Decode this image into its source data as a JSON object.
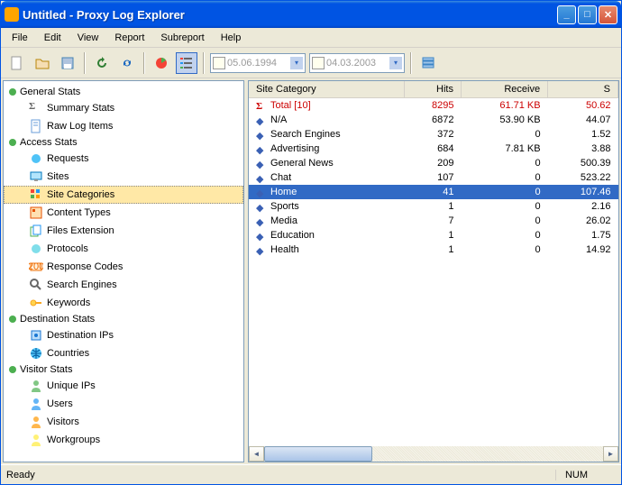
{
  "window": {
    "title": "Untitled - Proxy Log Explorer"
  },
  "menu": [
    "File",
    "Edit",
    "View",
    "Report",
    "Subreport",
    "Help"
  ],
  "dates": {
    "from": "05.06.1994",
    "to": "04.03.2003"
  },
  "tree": [
    {
      "type": "group",
      "label": "General Stats",
      "color": "#4caf50"
    },
    {
      "type": "item",
      "label": "Summary Stats",
      "icon": "sigma"
    },
    {
      "type": "item",
      "label": "Raw Log Items",
      "icon": "doc"
    },
    {
      "type": "group",
      "label": "Access Stats",
      "color": "#4caf50"
    },
    {
      "type": "item",
      "label": "Requests",
      "icon": "ball-blue"
    },
    {
      "type": "item",
      "label": "Sites",
      "icon": "monitor"
    },
    {
      "type": "item",
      "label": "Site Categories",
      "icon": "grid",
      "selected": true
    },
    {
      "type": "item",
      "label": "Content Types",
      "icon": "content"
    },
    {
      "type": "item",
      "label": "Files Extension",
      "icon": "files"
    },
    {
      "type": "item",
      "label": "Protocols",
      "icon": "ball-cyan"
    },
    {
      "type": "item",
      "label": "Response Codes",
      "icon": "response"
    },
    {
      "type": "item",
      "label": "Search Engines",
      "icon": "search"
    },
    {
      "type": "item",
      "label": "Keywords",
      "icon": "key"
    },
    {
      "type": "group",
      "label": "Destination Stats",
      "color": "#4caf50"
    },
    {
      "type": "item",
      "label": "Destination IPs",
      "icon": "dest"
    },
    {
      "type": "item",
      "label": "Countries",
      "icon": "globe"
    },
    {
      "type": "group",
      "label": "Visitor Stats",
      "color": "#4caf50"
    },
    {
      "type": "item",
      "label": "Unique IPs",
      "icon": "user-green"
    },
    {
      "type": "item",
      "label": "Users",
      "icon": "user-blue"
    },
    {
      "type": "item",
      "label": "Visitors",
      "icon": "user-orange"
    },
    {
      "type": "item",
      "label": "Workgroups",
      "icon": "user-yellow"
    }
  ],
  "table": {
    "columns": [
      "Site Category",
      "Hits",
      "Receive",
      "S"
    ],
    "rows": [
      {
        "type": "total",
        "label": "Total [10]",
        "hits": "8295",
        "recv": "61.71 KB",
        "s": "50.62"
      },
      {
        "type": "data",
        "label": "N/A",
        "hits": "6872",
        "recv": "53.90 KB",
        "s": "44.07"
      },
      {
        "type": "data",
        "label": "Search Engines",
        "hits": "372",
        "recv": "0",
        "s": "1.52"
      },
      {
        "type": "data",
        "label": "Advertising",
        "hits": "684",
        "recv": "7.81 KB",
        "s": "3.88"
      },
      {
        "type": "data",
        "label": "General News",
        "hits": "209",
        "recv": "0",
        "s": "500.39"
      },
      {
        "type": "data",
        "label": "Chat",
        "hits": "107",
        "recv": "0",
        "s": "523.22"
      },
      {
        "type": "data",
        "label": "Home",
        "hits": "41",
        "recv": "0",
        "s": "107.46",
        "selected": true
      },
      {
        "type": "data",
        "label": "Sports",
        "hits": "1",
        "recv": "0",
        "s": "2.16"
      },
      {
        "type": "data",
        "label": "Media",
        "hits": "7",
        "recv": "0",
        "s": "26.02"
      },
      {
        "type": "data",
        "label": "Education",
        "hits": "1",
        "recv": "0",
        "s": "1.75"
      },
      {
        "type": "data",
        "label": "Health",
        "hits": "1",
        "recv": "0",
        "s": "14.92"
      }
    ]
  },
  "status": {
    "ready": "Ready",
    "num": "NUM"
  }
}
